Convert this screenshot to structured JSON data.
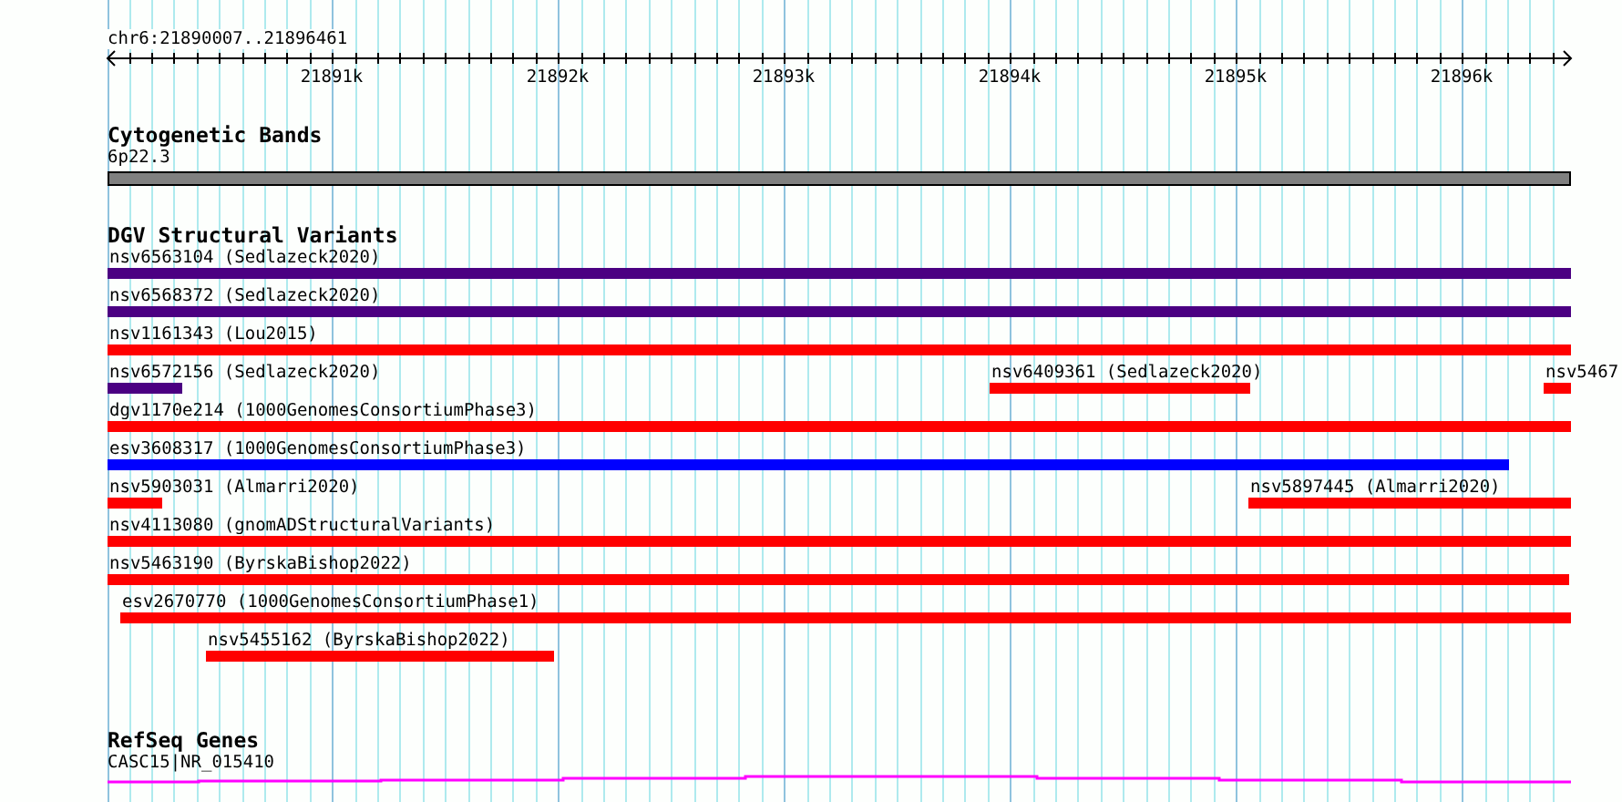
{
  "ruler": {
    "location": "chr6:21890007..21896461",
    "ticks": [
      "21891k",
      "21892k",
      "21893k",
      "21894k",
      "21895k",
      "21896k"
    ]
  },
  "cytoband_track": {
    "title": "Cytogenetic Bands",
    "bands": [
      {
        "label": "6p22.3"
      }
    ]
  },
  "dgv_track": {
    "title": "DGV Structural Variants",
    "rows": [
      {
        "features": [
          {
            "label": "nsv6563104 (Sedlazeck2020)",
            "color": "#4b0082"
          }
        ]
      },
      {
        "features": [
          {
            "label": "nsv6568372 (Sedlazeck2020)",
            "color": "#4b0082"
          }
        ]
      },
      {
        "features": [
          {
            "label": "nsv1161343 (Lou2015)",
            "color": "#ff0000"
          }
        ]
      },
      {
        "features": [
          {
            "label": "nsv6572156 (Sedlazeck2020)",
            "color": "#4b0082"
          },
          {
            "label": "nsv6409361 (Sedlazeck2020)",
            "color": "#ff0000"
          },
          {
            "label": "nsv5467",
            "color": "#ff0000"
          }
        ]
      },
      {
        "features": [
          {
            "label": "dgv1170e214 (1000GenomesConsortiumPhase3)",
            "color": "#ff0000"
          }
        ]
      },
      {
        "features": [
          {
            "label": "esv3608317 (1000GenomesConsortiumPhase3)",
            "color": "#0000ff"
          }
        ]
      },
      {
        "features": [
          {
            "label": "nsv5903031 (Almarri2020)",
            "color": "#ff0000"
          },
          {
            "label": "nsv5897445 (Almarri2020)",
            "color": "#ff0000"
          }
        ]
      },
      {
        "features": [
          {
            "label": "nsv4113080 (gnomADStructuralVariants)",
            "color": "#ff0000"
          }
        ]
      },
      {
        "features": [
          {
            "label": "nsv5463190 (ByrskaBishop2022)",
            "color": "#ff0000"
          }
        ]
      },
      {
        "features": [
          {
            "label": "esv2670770 (1000GenomesConsortiumPhase1)",
            "color": "#ff0000"
          }
        ]
      },
      {
        "features": [
          {
            "label": "nsv5455162 (ByrskaBishop2022)",
            "color": "#ff0000"
          }
        ]
      }
    ]
  },
  "refseq_track": {
    "title": "RefSeq Genes",
    "genes": [
      {
        "label": "CASC15|NR_015410"
      }
    ]
  }
}
